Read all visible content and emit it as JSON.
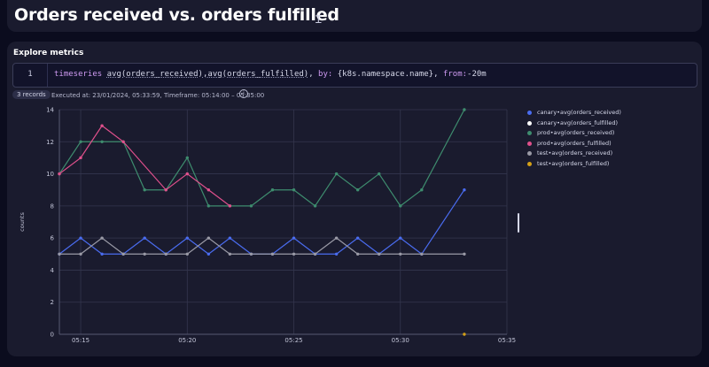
{
  "page_title": "Orders received vs. orders fulfilled",
  "panel": {
    "title": "Explore metrics"
  },
  "editor": {
    "line_number": "1",
    "query": {
      "kw_timeseries": "timeseries",
      "expr1": "avg(orders_received)",
      "expr_sep": ",",
      "expr2": "avg(orders_fulfilled)",
      "comma1": ", ",
      "kw_by": "by:",
      "by_value": " {k8s.namespace.name}, ",
      "kw_from": "from:",
      "from_value": "-20m"
    }
  },
  "cursor_glyph": "Ɪ",
  "records_badge": "3 records",
  "executed_info": "Executed at: 23/01/2024, 05:33:59, Timeframe: 05:14:00 – 05:35:00",
  "info_glyph": "i",
  "colors": {
    "canary_received": "#4a6cf0",
    "canary_fulfilled": "#ffffff",
    "prod_received": "#3e8c6e",
    "prod_fulfilled": "#e0508c",
    "test_received": "#9a9aa6",
    "test_fulfilled": "#d4a017",
    "grid": "#34364e",
    "axis_text": "#c3c5d8"
  },
  "chart_data": {
    "type": "line",
    "ylabel": "counts",
    "xlabel": "",
    "ylim": [
      0,
      14
    ],
    "xlim": [
      "05:14:00",
      "05:35:00"
    ],
    "yticks": [
      0,
      2,
      4,
      6,
      8,
      10,
      12,
      14
    ],
    "xticks": [
      "05:15",
      "05:20",
      "05:25",
      "05:30",
      "05:35"
    ],
    "x": [
      "05:14",
      "05:15",
      "05:16",
      "05:17",
      "05:18",
      "05:19",
      "05:20",
      "05:21",
      "05:22",
      "05:23",
      "05:24",
      "05:25",
      "05:26",
      "05:27",
      "05:28",
      "05:29",
      "05:30",
      "05:31",
      "05:32",
      "05:33"
    ],
    "legend_position": "right",
    "grid": true,
    "series": [
      {
        "name": "canary•avg(orders_received)",
        "color": "#4a6cf0",
        "values": [
          5,
          6,
          5,
          5,
          6,
          5,
          6,
          5,
          6,
          5,
          5,
          6,
          5,
          5,
          6,
          5,
          6,
          5,
          null,
          9
        ]
      },
      {
        "name": "canary•avg(orders_fulfilled)",
        "color": "#ffffff",
        "values": [
          null,
          null,
          null,
          null,
          null,
          null,
          null,
          null,
          null,
          null,
          null,
          null,
          null,
          null,
          null,
          null,
          null,
          null,
          null,
          null
        ]
      },
      {
        "name": "prod•avg(orders_received)",
        "color": "#3e8c6e",
        "values": [
          10,
          12,
          12,
          12,
          9,
          9,
          11,
          8,
          8,
          8,
          9,
          9,
          8,
          10,
          9,
          10,
          8,
          9,
          null,
          14
        ]
      },
      {
        "name": "prod•avg(orders_fulfilled)",
        "color": "#e0508c",
        "values": [
          10,
          11,
          13,
          12,
          null,
          9,
          10,
          9,
          8,
          null,
          null,
          null,
          null,
          null,
          null,
          null,
          null,
          null,
          null,
          null
        ]
      },
      {
        "name": "test•avg(orders_received)",
        "color": "#9a9aa6",
        "values": [
          5,
          5,
          6,
          5,
          5,
          5,
          5,
          6,
          5,
          5,
          5,
          5,
          5,
          6,
          5,
          5,
          5,
          5,
          null,
          5
        ]
      },
      {
        "name": "test•avg(orders_fulfilled)",
        "color": "#d4a017",
        "values": [
          null,
          null,
          null,
          null,
          null,
          null,
          null,
          null,
          null,
          null,
          null,
          null,
          null,
          null,
          null,
          null,
          null,
          null,
          null,
          0
        ]
      }
    ]
  }
}
